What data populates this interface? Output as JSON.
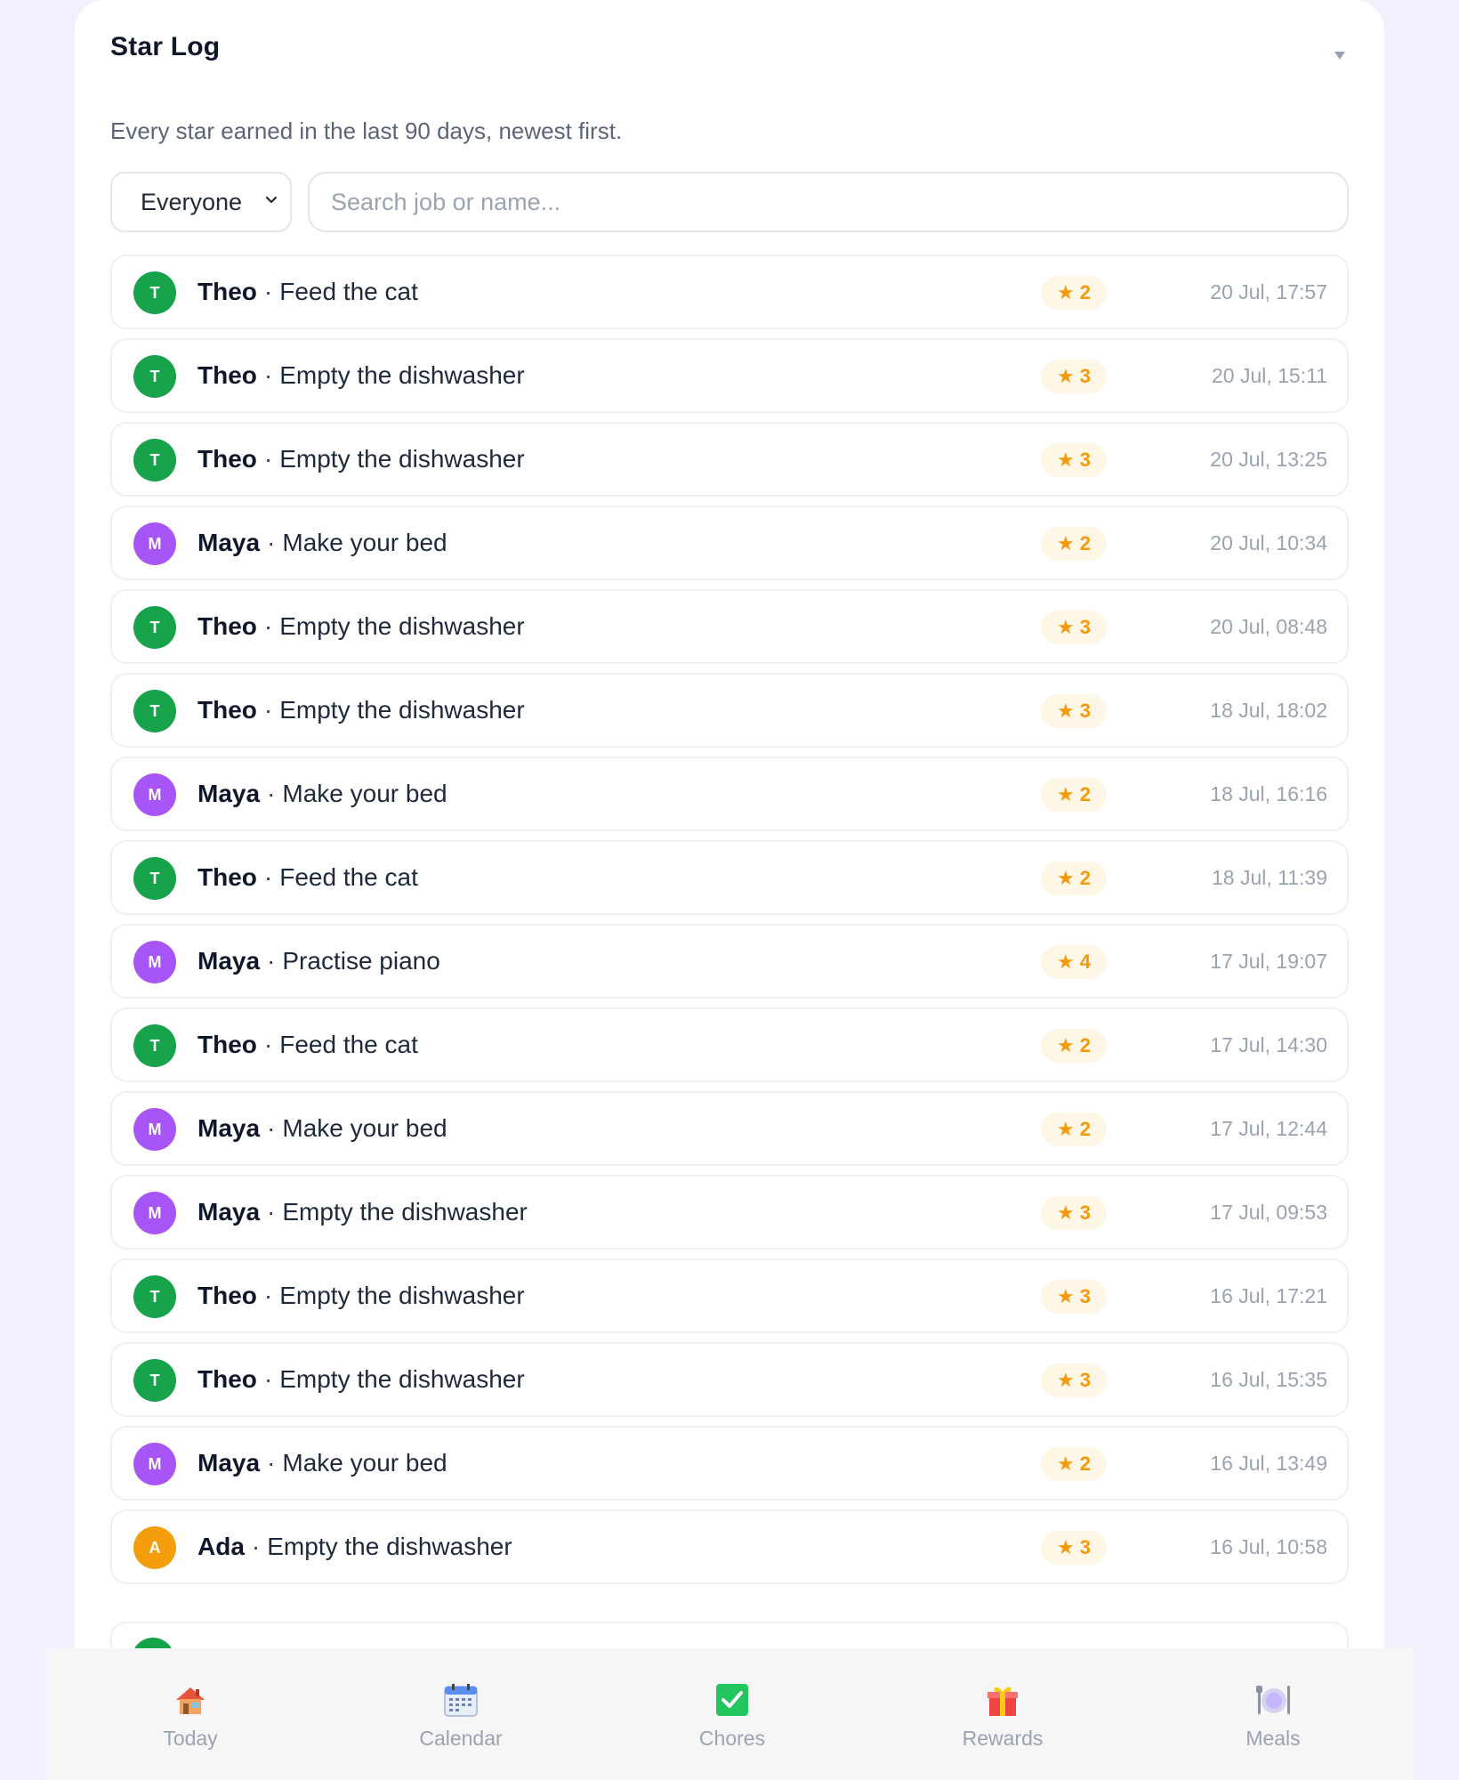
{
  "header": {
    "title": "Star Log",
    "subtitle": "Every star earned in the last 90 days, newest first."
  },
  "filters": {
    "person_selected": "Everyone",
    "search_placeholder": "Search job or name..."
  },
  "colors": {
    "theo": "#16a34a",
    "maya": "#a855f7",
    "ada": "#f59e0b",
    "star": "#f29a0e"
  },
  "entries": [
    {
      "initial": "T",
      "name": "Theo",
      "job": "Feed the cat",
      "stars": "2",
      "time": "20 Jul, 17:57",
      "color": "#16a34a"
    },
    {
      "initial": "T",
      "name": "Theo",
      "job": "Empty the dishwasher",
      "stars": "3",
      "time": "20 Jul, 15:11",
      "color": "#16a34a"
    },
    {
      "initial": "T",
      "name": "Theo",
      "job": "Empty the dishwasher",
      "stars": "3",
      "time": "20 Jul, 13:25",
      "color": "#16a34a"
    },
    {
      "initial": "M",
      "name": "Maya",
      "job": "Make your bed",
      "stars": "2",
      "time": "20 Jul, 10:34",
      "color": "#a855f7"
    },
    {
      "initial": "T",
      "name": "Theo",
      "job": "Empty the dishwasher",
      "stars": "3",
      "time": "20 Jul, 08:48",
      "color": "#16a34a"
    },
    {
      "initial": "T",
      "name": "Theo",
      "job": "Empty the dishwasher",
      "stars": "3",
      "time": "18 Jul, 18:02",
      "color": "#16a34a"
    },
    {
      "initial": "M",
      "name": "Maya",
      "job": "Make your bed",
      "stars": "2",
      "time": "18 Jul, 16:16",
      "color": "#a855f7"
    },
    {
      "initial": "T",
      "name": "Theo",
      "job": "Feed the cat",
      "stars": "2",
      "time": "18 Jul, 11:39",
      "color": "#16a34a"
    },
    {
      "initial": "M",
      "name": "Maya",
      "job": "Practise piano",
      "stars": "4",
      "time": "17 Jul, 19:07",
      "color": "#a855f7"
    },
    {
      "initial": "T",
      "name": "Theo",
      "job": "Feed the cat",
      "stars": "2",
      "time": "17 Jul, 14:30",
      "color": "#16a34a"
    },
    {
      "initial": "M",
      "name": "Maya",
      "job": "Make your bed",
      "stars": "2",
      "time": "17 Jul, 12:44",
      "color": "#a855f7"
    },
    {
      "initial": "M",
      "name": "Maya",
      "job": "Empty the dishwasher",
      "stars": "3",
      "time": "17 Jul, 09:53",
      "color": "#a855f7"
    },
    {
      "initial": "T",
      "name": "Theo",
      "job": "Empty the dishwasher",
      "stars": "3",
      "time": "16 Jul, 17:21",
      "color": "#16a34a"
    },
    {
      "initial": "T",
      "name": "Theo",
      "job": "Empty the dishwasher",
      "stars": "3",
      "time": "16 Jul, 15:35",
      "color": "#16a34a"
    },
    {
      "initial": "M",
      "name": "Maya",
      "job": "Make your bed",
      "stars": "2",
      "time": "16 Jul, 13:49",
      "color": "#a855f7"
    },
    {
      "initial": "A",
      "name": "Ada",
      "job": "Empty the dishwasher",
      "stars": "3",
      "time": "16 Jul, 10:58",
      "color": "#f59e0b"
    }
  ],
  "tabbar": {
    "tabs": [
      {
        "label": "Today",
        "icon": "house-icon"
      },
      {
        "label": "Calendar",
        "icon": "calendar-icon"
      },
      {
        "label": "Chores",
        "icon": "check-box-icon"
      },
      {
        "label": "Rewards",
        "icon": "gift-icon"
      },
      {
        "label": "Meals",
        "icon": "plate-cutlery-icon"
      }
    ]
  }
}
